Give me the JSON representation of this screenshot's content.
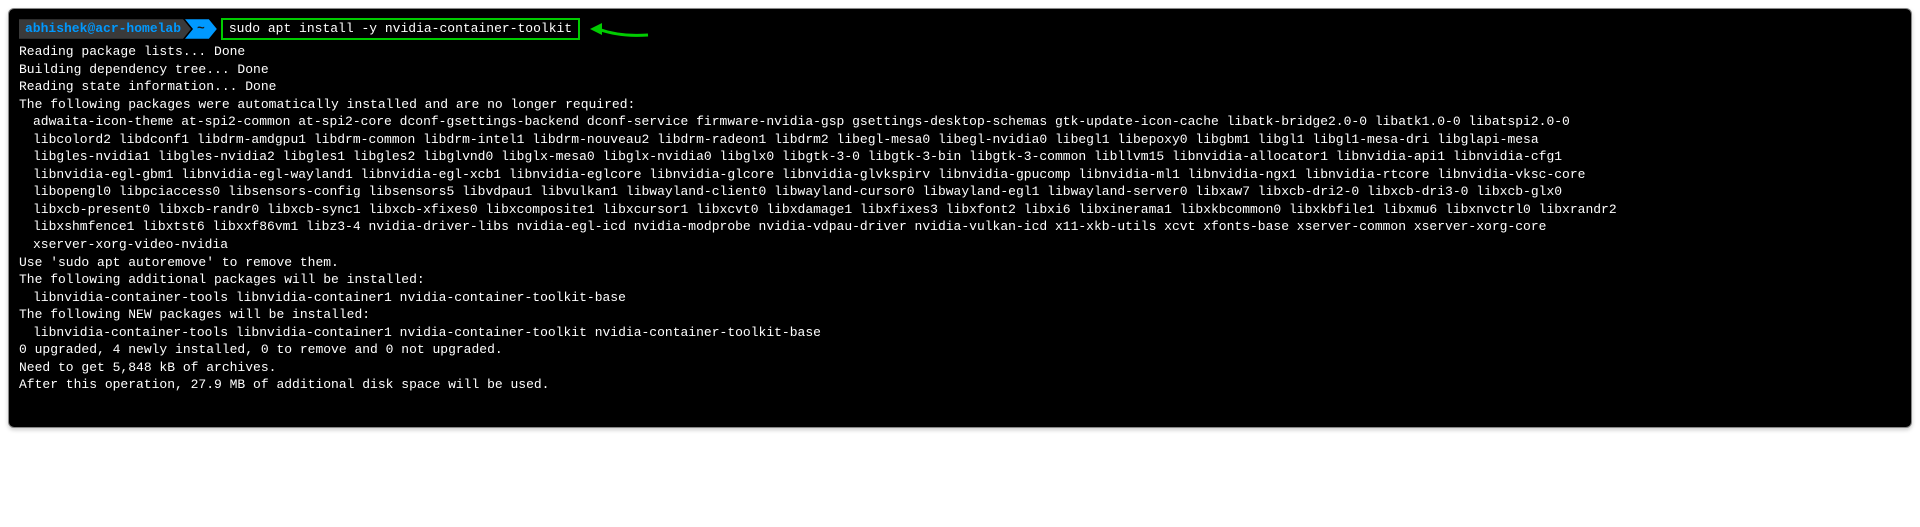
{
  "prompt": {
    "user_host": "abhishek@acr-homelab",
    "path": "~",
    "command": "sudo apt install -y nvidia-container-toolkit"
  },
  "output": {
    "l1": "Reading package lists... Done",
    "l2": "Building dependency tree... Done",
    "l3": "Reading state information... Done",
    "l4": "The following packages were automatically installed and are no longer required:",
    "l5": "adwaita-icon-theme at-spi2-common at-spi2-core dconf-gsettings-backend dconf-service firmware-nvidia-gsp gsettings-desktop-schemas gtk-update-icon-cache libatk-bridge2.0-0 libatk1.0-0 libatspi2.0-0",
    "l6": "libcolord2 libdconf1 libdrm-amdgpu1 libdrm-common libdrm-intel1 libdrm-nouveau2 libdrm-radeon1 libdrm2 libegl-mesa0 libegl-nvidia0 libegl1 libepoxy0 libgbm1 libgl1 libgl1-mesa-dri libglapi-mesa",
    "l7": "libgles-nvidia1 libgles-nvidia2 libgles1 libgles2 libglvnd0 libglx-mesa0 libglx-nvidia0 libglx0 libgtk-3-0 libgtk-3-bin libgtk-3-common libllvm15 libnvidia-allocator1 libnvidia-api1 libnvidia-cfg1",
    "l8": "libnvidia-egl-gbm1 libnvidia-egl-wayland1 libnvidia-egl-xcb1 libnvidia-eglcore libnvidia-glcore libnvidia-glvkspirv libnvidia-gpucomp libnvidia-ml1 libnvidia-ngx1 libnvidia-rtcore libnvidia-vksc-core",
    "l9": "libopengl0 libpciaccess0 libsensors-config libsensors5 libvdpau1 libvulkan1 libwayland-client0 libwayland-cursor0 libwayland-egl1 libwayland-server0 libxaw7 libxcb-dri2-0 libxcb-dri3-0 libxcb-glx0",
    "l10": "libxcb-present0 libxcb-randr0 libxcb-sync1 libxcb-xfixes0 libxcomposite1 libxcursor1 libxcvt0 libxdamage1 libxfixes3 libxfont2 libxi6 libxinerama1 libxkbcommon0 libxkbfile1 libxmu6 libxnvctrl0 libxrandr2",
    "l11": "libxshmfence1 libxtst6 libxxf86vm1 libz3-4 nvidia-driver-libs nvidia-egl-icd nvidia-modprobe nvidia-vdpau-driver nvidia-vulkan-icd x11-xkb-utils xcvt xfonts-base xserver-common xserver-xorg-core",
    "l12": "xserver-xorg-video-nvidia",
    "l13": "Use 'sudo apt autoremove' to remove them.",
    "l14": "The following additional packages will be installed:",
    "l15": "libnvidia-container-tools libnvidia-container1 nvidia-container-toolkit-base",
    "l16": "The following NEW packages will be installed:",
    "l17": "libnvidia-container-tools libnvidia-container1 nvidia-container-toolkit nvidia-container-toolkit-base",
    "l18": "0 upgraded, 4 newly installed, 0 to remove and 0 not upgraded.",
    "l19": "Need to get 5,848 kB of archives.",
    "l20": "After this operation, 27.9 MB of additional disk space will be used."
  }
}
